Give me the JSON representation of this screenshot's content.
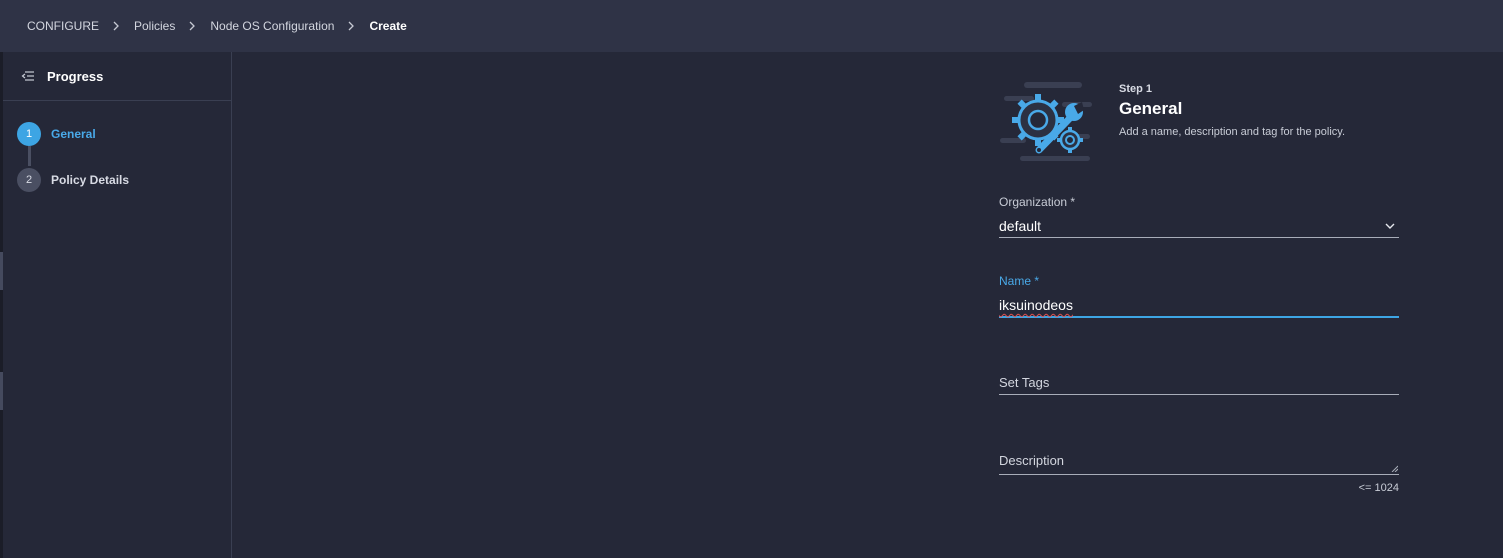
{
  "breadcrumb": {
    "items": [
      "CONFIGURE",
      "Policies",
      "Node OS Configuration"
    ],
    "current": "Create"
  },
  "sidebar": {
    "title": "Progress",
    "steps": [
      {
        "number": "1",
        "label": "General",
        "active": true
      },
      {
        "number": "2",
        "label": "Policy Details",
        "active": false
      }
    ]
  },
  "step_header": {
    "step": "Step 1",
    "title": "General",
    "description": "Add a name, description and tag for the policy."
  },
  "form": {
    "organization": {
      "label": "Organization *",
      "value": "default"
    },
    "name": {
      "label": "Name *",
      "value": "iksuinodeos"
    },
    "tags": {
      "placeholder": "Set Tags"
    },
    "description": {
      "placeholder": "Description",
      "counter": "<= 1024"
    }
  },
  "icons": {
    "breadcrumb_separator": "chevron-right-icon",
    "sidebar_toggle": "collapse-menu-icon",
    "organization_dropdown": "chevron-down-icon",
    "illustration": "gear-wrench-icon"
  },
  "colors": {
    "accent": "#3da5e4",
    "background": "#252838",
    "topbar": "#2f3346"
  }
}
